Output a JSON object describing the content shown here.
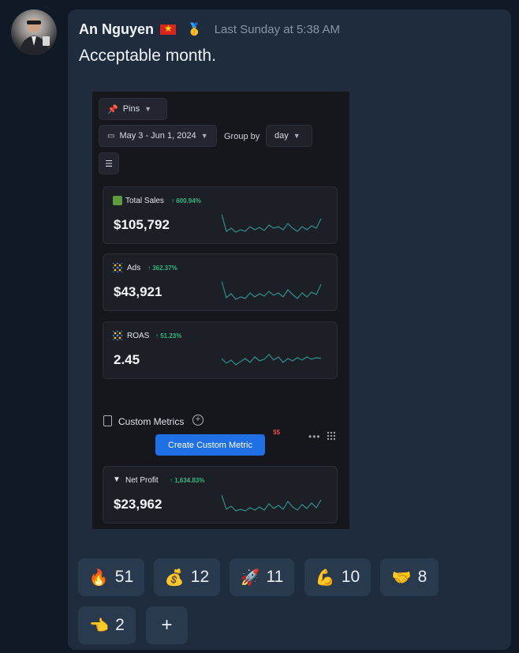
{
  "message": {
    "author": "An Nguyen",
    "timestamp": "Last Sunday at 5:38 AM",
    "text": "Acceptable month."
  },
  "dashboard": {
    "pins_label": "Pins",
    "date_range": "May 3 - Jun 1, 2024",
    "group_by_label": "Group by",
    "group_by_value": "day",
    "metrics": [
      {
        "name": "Total Sales",
        "change": "600.94%",
        "value": "$105,792",
        "icon": "shopify-bag-icon"
      },
      {
        "name": "Ads",
        "change": "362.37%",
        "value": "$43,921",
        "icon": "ads-sparkle-icon"
      },
      {
        "name": "ROAS",
        "change": "51.23%",
        "value": "2.45",
        "icon": "roas-sparkle-icon"
      }
    ],
    "custom_metrics_label": "Custom Metrics",
    "create_button_label": "Create Custom Metric",
    "net_profit": {
      "name": "Net Profit",
      "change": "1,634.83%",
      "value": "$23,962",
      "icon": "funnel-icon"
    },
    "accent_green": "#31b67e",
    "accent_blue": "#1f6fe5"
  },
  "reactions": [
    {
      "emoji": "🔥",
      "count": "51",
      "icon": "fire-emoji"
    },
    {
      "emoji": "💰",
      "count": "12",
      "icon": "money-bag-emoji"
    },
    {
      "emoji": "🚀",
      "count": "11",
      "icon": "rocket-emoji"
    },
    {
      "emoji": "💪",
      "count": "10",
      "icon": "flexed-biceps-emoji"
    },
    {
      "emoji": "🤝",
      "count": "8",
      "icon": "handshake-emoji"
    },
    {
      "emoji": "👈",
      "count": "2",
      "icon": "pointing-hand-emoji"
    }
  ],
  "add_reaction_label": "+"
}
